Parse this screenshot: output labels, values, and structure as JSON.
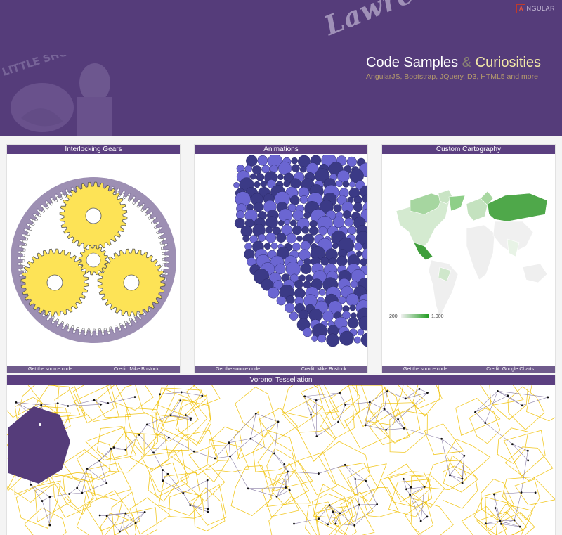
{
  "header": {
    "angular_badge": "NGULAR",
    "signature": "Lawrence's",
    "title_part1": "Code Samples ",
    "title_amp": "&",
    "title_part2": " Curiosities",
    "subtitle": "AngularJS, Bootstrap, JQuery, D3, HTML5 and more",
    "poster_text": "LITTLE SHOP"
  },
  "panels": [
    {
      "title": "Interlocking Gears",
      "source_label": "Get the source code",
      "credit": "Credit: Mike Bostock"
    },
    {
      "title": "Animations",
      "source_label": "Get the source code",
      "credit": "Credit: Mike Bostock"
    },
    {
      "title": "Custom Cartography",
      "source_label": "Get the source code",
      "credit": "Credit: Google Charts"
    },
    {
      "title": "Voronoi Tessellation"
    }
  ],
  "map_legend": {
    "min_label": "200",
    "max_label": "1,000"
  },
  "colors": {
    "header_bg": "#553c7a",
    "panel_title_bg": "#5b3f80",
    "gear_fill": "#fde356",
    "voronoi_cell": "#f0c000",
    "voronoi_link": "#8a7ea6"
  }
}
